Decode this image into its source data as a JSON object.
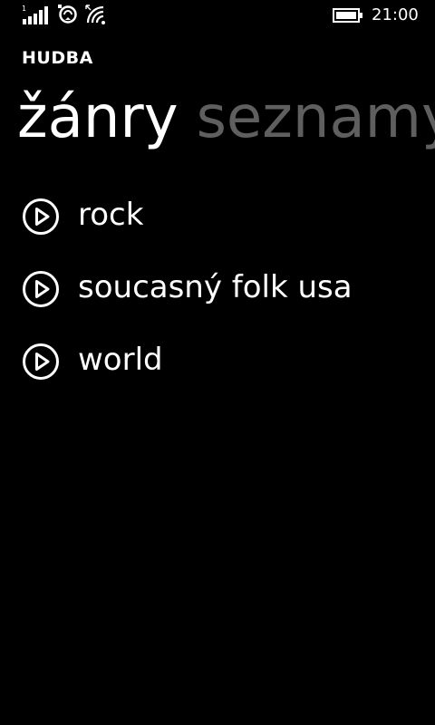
{
  "status_bar": {
    "signal_icon": "signal-strength-icon",
    "data_icon": "data-sync-icon",
    "wifi_icon": "wifi-icon",
    "battery_icon": "battery-icon",
    "time": "21:00"
  },
  "header": {
    "app_title": "HUDBA",
    "pivot_tabs": [
      {
        "label": "žánry",
        "active": true
      },
      {
        "label": "seznamy",
        "active": false
      }
    ]
  },
  "genres": [
    {
      "label": "rock",
      "icon": "play-circle-icon"
    },
    {
      "label": "soucasný folk usa",
      "icon": "play-circle-icon"
    },
    {
      "label": "world",
      "icon": "play-circle-icon"
    }
  ],
  "colors": {
    "background": "#000000",
    "foreground": "#ffffff",
    "inactive_tab": "#5f5f5f"
  }
}
